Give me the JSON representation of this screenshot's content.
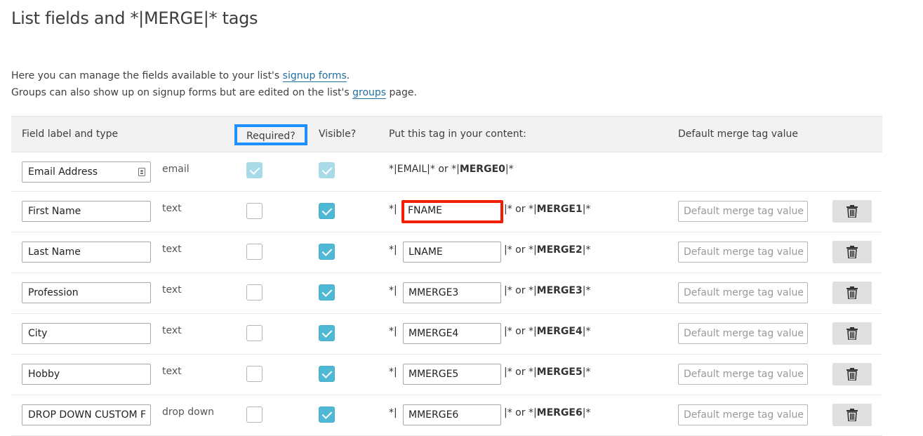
{
  "page_title": "List fields and *|MERGE|* tags",
  "intro": {
    "line1_before": "Here you can manage the fields available to your list's ",
    "line1_link": "signup forms",
    "line1_after": ".",
    "line2_before": "Groups can also show up on signup forms but are edited on the list's ",
    "line2_link": "groups",
    "line2_after": " page."
  },
  "table": {
    "headers": {
      "field": "Field label and type",
      "required": "Required?",
      "visible": "Visible?",
      "tag": "Put this tag in your content:",
      "default": "Default merge tag value"
    },
    "email_row": {
      "label": "Email Address",
      "type": "email",
      "tag_text_1": "*|EMAIL|* or *|",
      "tag_bold": "MERGE0",
      "tag_text_2": "|*",
      "icon": "contact-card-icon"
    },
    "rows": [
      {
        "label": "First Name",
        "type": "text",
        "required": false,
        "visible": true,
        "tag": "FNAME",
        "merge": "MERGE1",
        "placeholder": "Default merge tag value"
      },
      {
        "label": "Last Name",
        "type": "text",
        "required": false,
        "visible": true,
        "tag": "LNAME",
        "merge": "MERGE2",
        "placeholder": "Default merge tag value"
      },
      {
        "label": "Profession",
        "type": "text",
        "required": false,
        "visible": true,
        "tag": "MMERGE3",
        "merge": "MERGE3",
        "placeholder": "Default merge tag value"
      },
      {
        "label": "City",
        "type": "text",
        "required": false,
        "visible": true,
        "tag": "MMERGE4",
        "merge": "MERGE4",
        "placeholder": "Default merge tag value"
      },
      {
        "label": "Hobby",
        "type": "text",
        "required": false,
        "visible": true,
        "tag": "MMERGE5",
        "merge": "MERGE5",
        "placeholder": "Default merge tag value"
      },
      {
        "label": "DROP DOWN CUSTOM F",
        "type": "drop down",
        "required": false,
        "visible": true,
        "tag": "MMERGE6",
        "merge": "MERGE6",
        "placeholder": "Default merge tag value"
      }
    ],
    "tag_prefix": "*|",
    "tag_suffix_1": "|* or *|",
    "tag_suffix_2": "|*"
  },
  "colors": {
    "accent_check": "#4fb8d5",
    "required_highlight": "#1e8fff",
    "tag_highlight": "#f21e00",
    "link": "#1f6fa0"
  }
}
